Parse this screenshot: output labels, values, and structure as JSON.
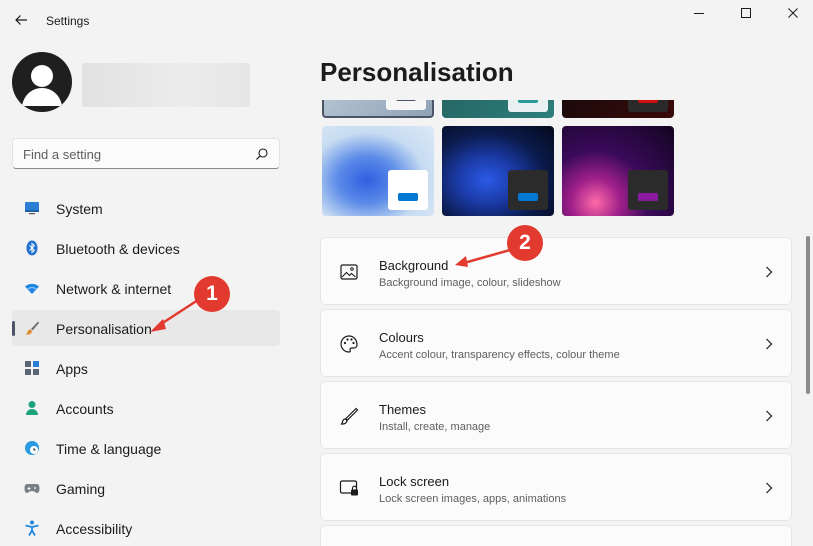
{
  "window": {
    "title": "Settings",
    "back_icon": "back-arrow-icon",
    "controls": [
      "minimize-icon",
      "maximize-icon",
      "close-icon"
    ]
  },
  "search": {
    "placeholder": "Find a setting",
    "icon": "search-icon"
  },
  "sidebar": {
    "items": [
      {
        "label": "System",
        "icon": "system-icon",
        "selected": false
      },
      {
        "label": "Bluetooth & devices",
        "icon": "bluetooth-icon",
        "selected": false
      },
      {
        "label": "Network & internet",
        "icon": "wifi-icon",
        "selected": false
      },
      {
        "label": "Personalisation",
        "icon": "brush-icon",
        "selected": true
      },
      {
        "label": "Apps",
        "icon": "apps-icon",
        "selected": false
      },
      {
        "label": "Accounts",
        "icon": "person-icon",
        "selected": false
      },
      {
        "label": "Time & language",
        "icon": "globe-clock-icon",
        "selected": false
      },
      {
        "label": "Gaming",
        "icon": "gamepad-icon",
        "selected": false
      },
      {
        "label": "Accessibility",
        "icon": "accessibility-icon",
        "selected": false
      }
    ]
  },
  "main": {
    "title": "Personalisation",
    "cards": [
      {
        "title": "Background",
        "subtitle": "Background image, colour, slideshow",
        "icon": "picture-icon"
      },
      {
        "title": "Colours",
        "subtitle": "Accent colour, transparency effects, colour theme",
        "icon": "palette-icon"
      },
      {
        "title": "Themes",
        "subtitle": "Install, create, manage",
        "icon": "pen-icon"
      },
      {
        "title": "Lock screen",
        "subtitle": "Lock screen images, apps, animations",
        "icon": "lock-screen-icon"
      }
    ]
  },
  "annotations": {
    "marker_1": "1",
    "marker_2": "2",
    "color": "#e23a2e"
  },
  "colors": {
    "accent": "#0078d4",
    "background": "#f3f3f3",
    "card": "#fbfbfb"
  }
}
